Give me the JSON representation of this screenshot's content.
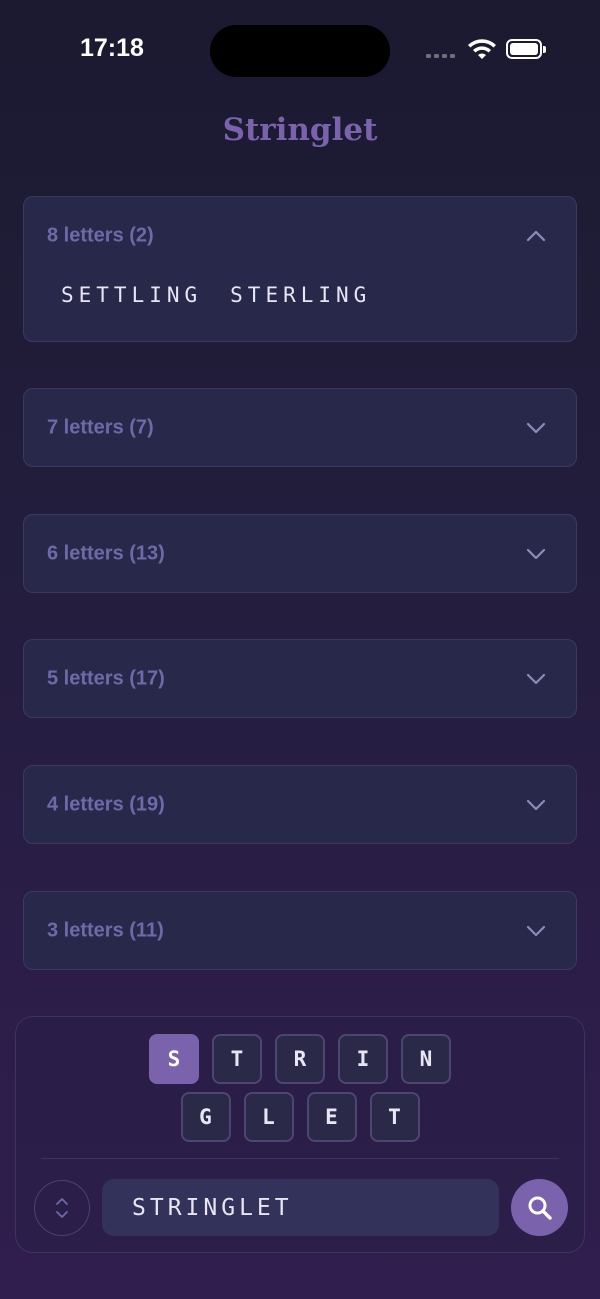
{
  "status_bar": {
    "time": "17:18"
  },
  "app": {
    "title": "Stringlet"
  },
  "groups": [
    {
      "label": "8 letters (2)",
      "expanded": true,
      "words": [
        "SETTLING",
        "STERLING"
      ]
    },
    {
      "label": "7 letters (7)",
      "expanded": false
    },
    {
      "label": "6 letters (13)",
      "expanded": false
    },
    {
      "label": "5 letters (17)",
      "expanded": false
    },
    {
      "label": "4 letters (19)",
      "expanded": false
    },
    {
      "label": "3 letters (11)",
      "expanded": false
    }
  ],
  "tiles": {
    "row1": [
      "S",
      "T",
      "R",
      "I",
      "N"
    ],
    "row2": [
      "G",
      "L",
      "E",
      "T"
    ],
    "selected": "S"
  },
  "input": {
    "value": "STRINGLET"
  },
  "colors": {
    "accent": "#7a62ad",
    "card": "#28284a",
    "label": "#6e6aa8"
  }
}
